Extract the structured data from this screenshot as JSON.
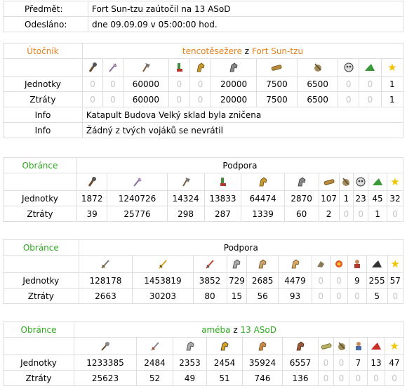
{
  "meta": [
    {
      "label": "Předmět:",
      "value": "Fort Sun-tzu zaútočil na 13 ASoD"
    },
    {
      "label": "Odesláno:",
      "value": "dne 09.09.09 v 05:00:00 hod."
    }
  ],
  "colors": {
    "attacker_label": "#e8811c",
    "defender_label": "#2eaa1e",
    "zero": "#c6c6c6",
    "border": "#dedede"
  },
  "attacker": {
    "role": "Útočník",
    "player": "tencotěsežere",
    "joiner": "z",
    "village": "Fort Sun-tzu",
    "icons": [
      "clubswinger-icon",
      "axeman-icon",
      "hatchet-icon",
      "boot-scout-icon",
      "horse-gold-icon",
      "horse-armored-icon",
      "battering-ram-icon",
      "catapult-icon",
      "mask-icon",
      "green-hat-icon",
      "star-icon"
    ],
    "rows": [
      {
        "label": "Jednotky",
        "values": [
          "0",
          "0",
          "60000",
          "0",
          "0",
          "20000",
          "7500",
          "6500",
          "0",
          "0",
          "1"
        ]
      },
      {
        "label": "Ztráty",
        "values": [
          "0",
          "0",
          "60000",
          "0",
          "0",
          "20000",
          "7500",
          "6500",
          "0",
          "0",
          "1"
        ]
      }
    ],
    "info": [
      {
        "label": "Info",
        "text": "Katapult Budova Velký sklad byla zničena"
      },
      {
        "label": "Info",
        "text": "Žádný z tvých vojáků se nevrátil"
      }
    ]
  },
  "defenders": [
    {
      "role": "Obránce",
      "title": "Podpora",
      "icons": [
        "clubswinger-icon",
        "axeman-icon",
        "hatchet-icon",
        "boot-scout-icon",
        "horse-gold-icon",
        "horse-armored-icon",
        "battering-ram-icon",
        "catapult-icon",
        "mask-icon",
        "green-hat-icon",
        "star-icon"
      ],
      "rows": [
        {
          "label": "Jednotky",
          "values": [
            "1872",
            "1240726",
            "14324",
            "13833",
            "64474",
            "2870",
            "107",
            "1",
            "23",
            "45",
            "32"
          ]
        },
        {
          "label": "Ztráty",
          "values": [
            "39",
            "25776",
            "298",
            "287",
            "1339",
            "60",
            "2",
            "0",
            "0",
            "1",
            "0"
          ]
        }
      ]
    },
    {
      "role": "Obránce",
      "title": "Podpora",
      "icons": [
        "sword-icon",
        "gold-sword-icon",
        "red-sword-icon",
        "horse-gray-icon",
        "horse-tan-icon",
        "horse-brown-icon",
        "ram-head-icon",
        "fireball-icon",
        "settler-icon",
        "black-hat-icon",
        "star-icon"
      ],
      "rows": [
        {
          "label": "Jednotky",
          "values": [
            "128178",
            "1453819",
            "3852",
            "729",
            "2685",
            "4479",
            "0",
            "0",
            "9",
            "255",
            "57"
          ]
        },
        {
          "label": "Ztráty",
          "values": [
            "2663",
            "30203",
            "80",
            "15",
            "56",
            "93",
            "0",
            "0",
            "0",
            "5",
            "0"
          ]
        }
      ]
    },
    {
      "role": "Obránce",
      "player": "améba",
      "joiner": "z",
      "village": "13 ASoD",
      "icons": [
        "mace-icon",
        "dagger-icon",
        "horse-gray-icon",
        "horse-gold-icon",
        "horse-tan-icon",
        "horse-brown-icon",
        "battering-ram-icon",
        "catapult-icon",
        "chief-icon",
        "red-hat-icon",
        "star-icon"
      ],
      "rows": [
        {
          "label": "Jednotky",
          "values": [
            "1233385",
            "2484",
            "2353",
            "2454",
            "35924",
            "6557",
            "0",
            "0",
            "7",
            "13",
            "47"
          ]
        },
        {
          "label": "Ztráty",
          "values": [
            "25623",
            "52",
            "49",
            "51",
            "746",
            "136",
            "0",
            "0",
            "0",
            "0",
            "0"
          ]
        }
      ]
    }
  ]
}
